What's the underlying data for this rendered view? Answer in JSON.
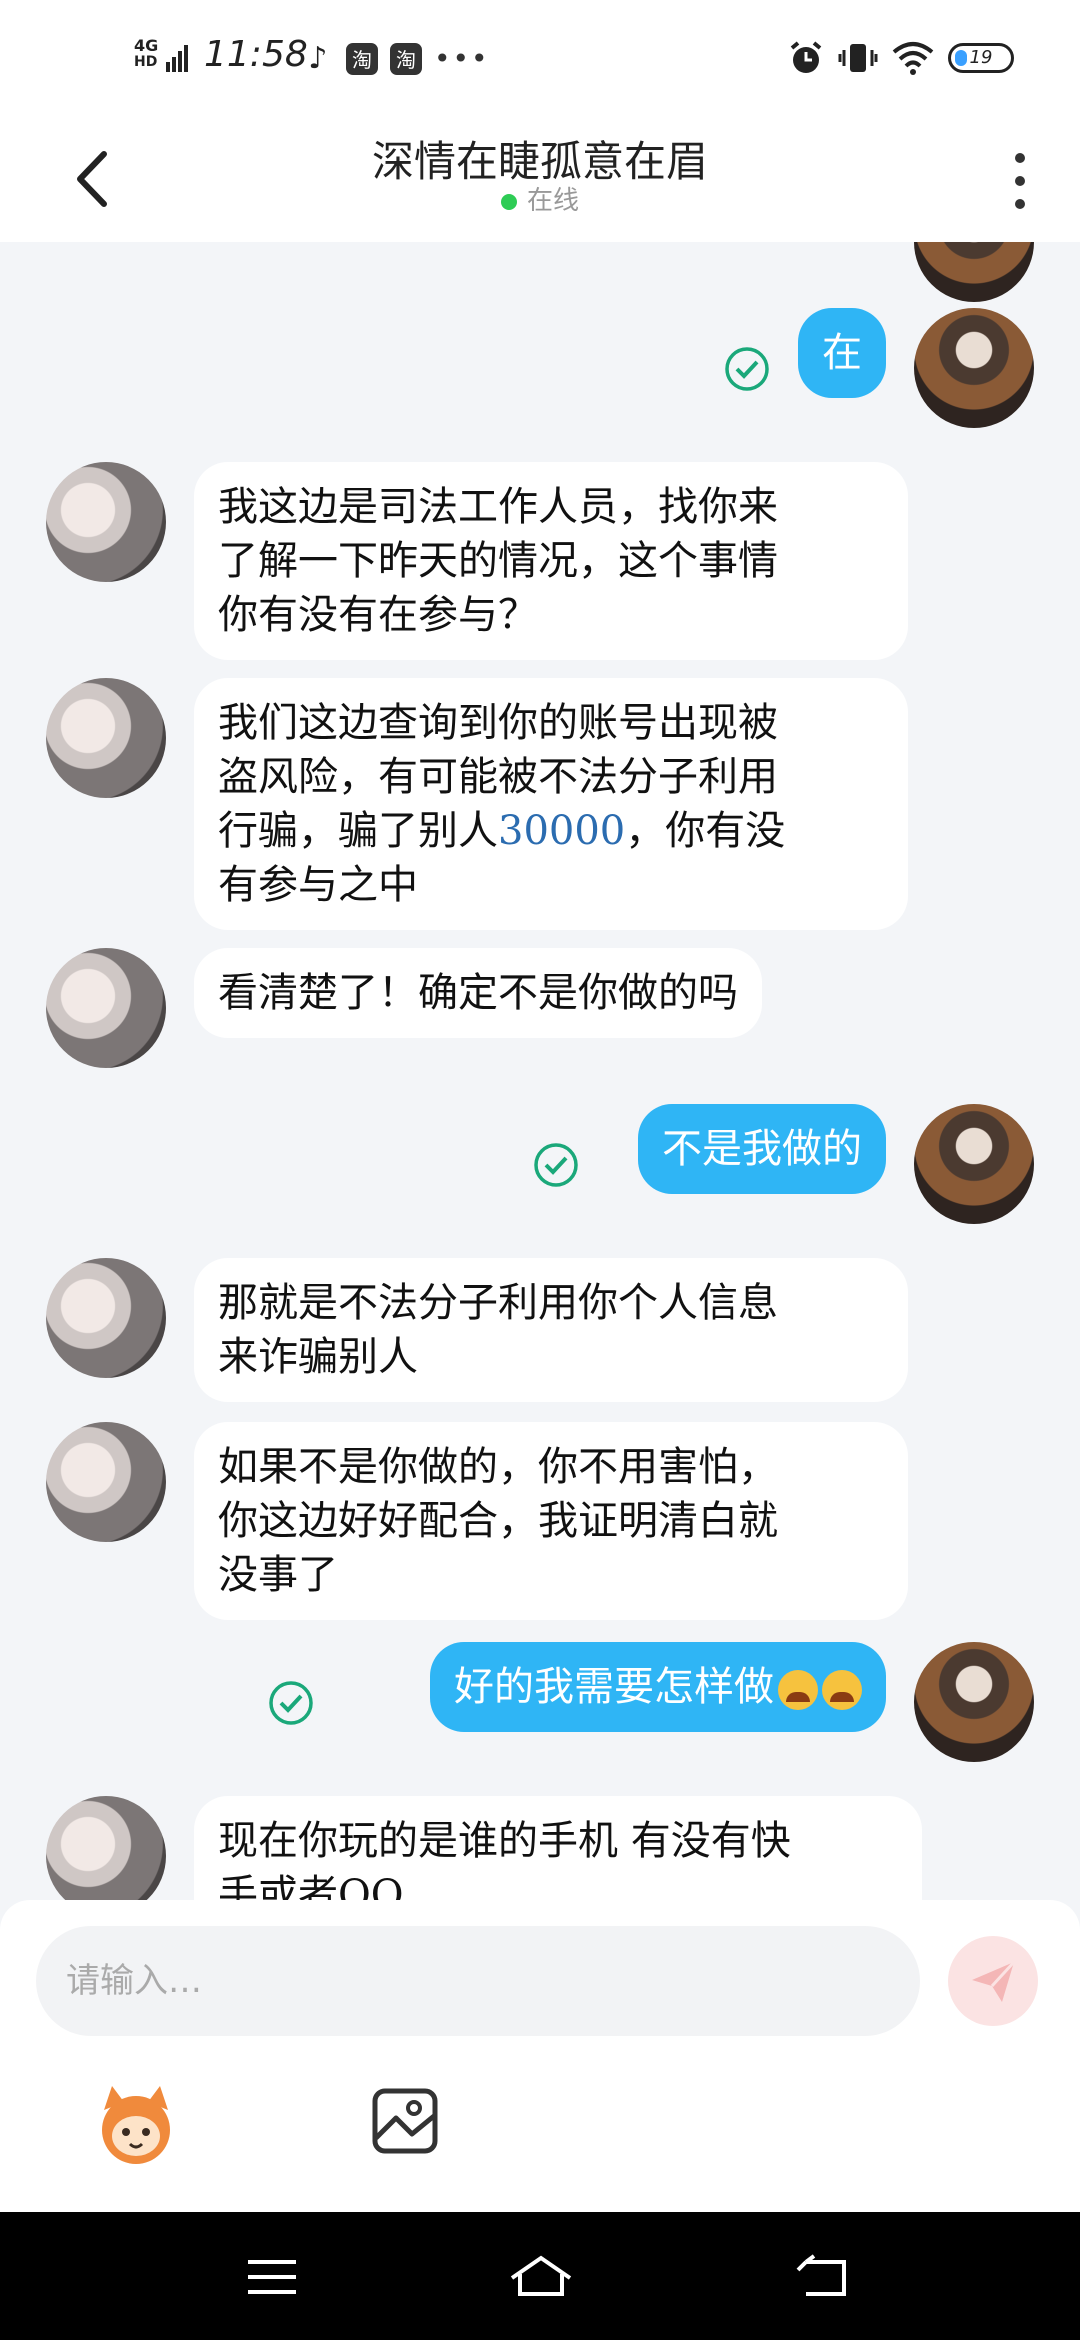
{
  "status_bar": {
    "network": "4G",
    "network_sub": "HD",
    "time": "11:58",
    "app_badges": [
      "♪",
      "淘",
      "淘"
    ],
    "more": "•••",
    "battery": "19"
  },
  "header": {
    "title": "深情在睫孤意在眉",
    "status": "在线"
  },
  "messages": [
    {
      "from": "self",
      "text": "在"
    },
    {
      "from": "other",
      "lines": [
        "我这边是司法工作人员，找你来",
        "了解一下昨天的情况，这个事情",
        "你有没有在参与？"
      ]
    },
    {
      "from": "other",
      "line1": "我们这边查询到你的账号出现被",
      "line2": "盗风险，有可能被不法分子利用",
      "line3_pre": "行骗，骗了别人",
      "line3_num": "30000",
      "line3_post": "，你有没",
      "line4": "有参与之中"
    },
    {
      "from": "other",
      "text": "看清楚了！确定不是你做的吗"
    },
    {
      "from": "self",
      "text": "不是我做的"
    },
    {
      "from": "other",
      "lines": [
        "那就是不法分子利用你个人信息",
        "来诈骗别人"
      ]
    },
    {
      "from": "other",
      "lines": [
        "如果不是你做的，你不用害怕，",
        "你这边好好配合，我证明清白就",
        "没事了"
      ]
    },
    {
      "from": "self",
      "text": "好的我需要怎样做"
    },
    {
      "from": "other",
      "lines": [
        "现在你玩的是谁的手机 有没有快",
        "手或者QQ"
      ]
    }
  ],
  "input": {
    "placeholder": "请输入…"
  },
  "colors": {
    "accent": "#2fb5f5",
    "online": "#2ecc55",
    "read": "#1aa87a"
  }
}
